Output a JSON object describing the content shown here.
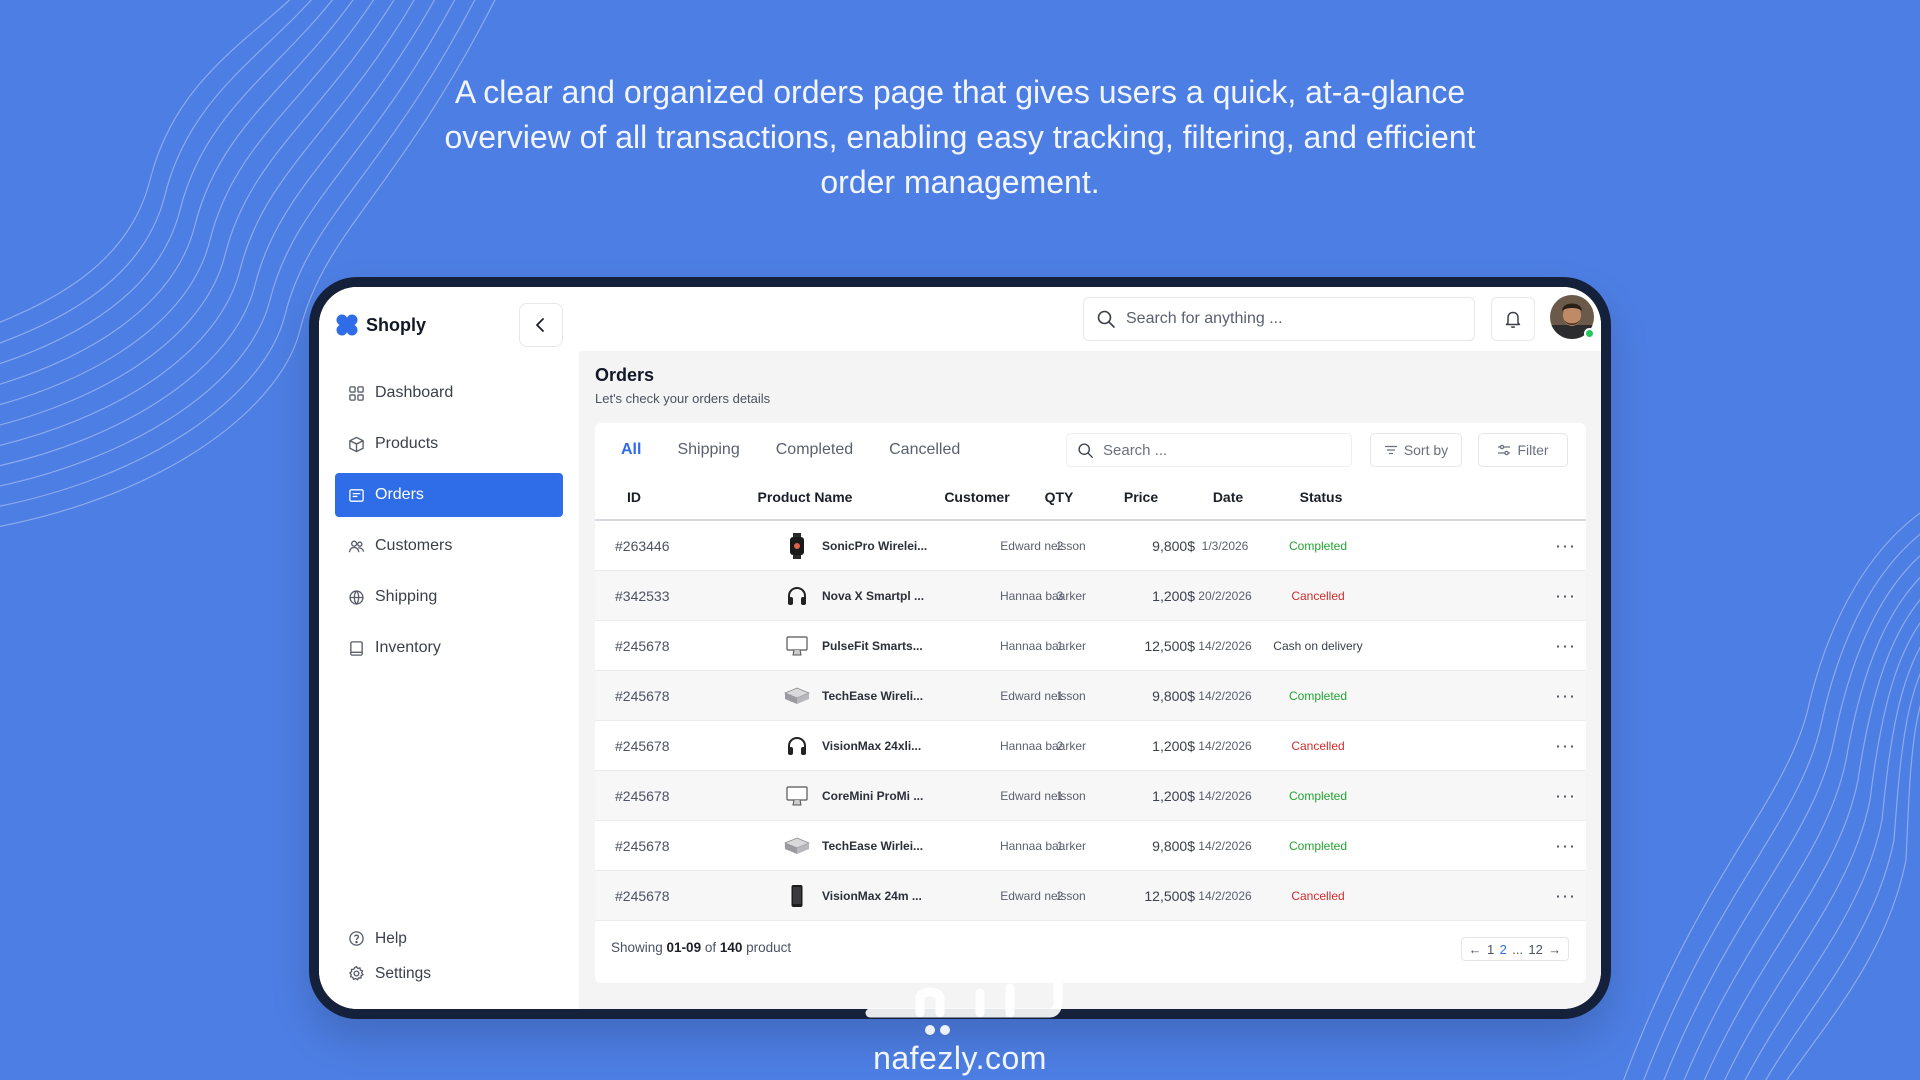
{
  "headline": {
    "line1": "A clear and organized orders page that gives users a quick, at-a-glance",
    "line2": "overview of all transactions, enabling easy tracking, filtering, and efficient",
    "line3": "order management."
  },
  "colors": {
    "accent": "#2f6de8",
    "background": "#4d7ee3",
    "completed": "#22a531",
    "cancelled": "#d12b2b"
  },
  "sidebar": {
    "brand": "Shoply",
    "items": [
      {
        "label": "Dashboard",
        "icon": "dashboard-icon"
      },
      {
        "label": "Products",
        "icon": "box-icon"
      },
      {
        "label": "Orders",
        "icon": "orders-icon",
        "active": true
      },
      {
        "label": "Customers",
        "icon": "users-icon"
      },
      {
        "label": "Shipping",
        "icon": "truck-icon"
      },
      {
        "label": "Inventory",
        "icon": "inventory-icon"
      }
    ],
    "bottom": [
      {
        "label": "Help",
        "icon": "help-icon"
      },
      {
        "label": "Settings",
        "icon": "gear-icon"
      }
    ]
  },
  "topbar": {
    "search_placeholder": "Search for anything ..."
  },
  "page": {
    "title": "Orders",
    "subtitle": "Let's check your orders details"
  },
  "tabs": [
    "All",
    "Shipping",
    "Completed",
    "Cancelled"
  ],
  "toolbar": {
    "search_placeholder": "Search ...",
    "sort_label": "Sort by",
    "filter_label": "Filter"
  },
  "table": {
    "headers": [
      "ID",
      "Product Name",
      "Customer",
      "QTY",
      "Price",
      "Date",
      "Status"
    ],
    "rows": [
      {
        "id": "#263446",
        "icon": "watch-icon",
        "name": "SonicPro Wirelei...",
        "customer": "Edward nelsson",
        "qty": "2",
        "price": "9,800$",
        "date": "1/3/2026",
        "status": "Completed"
      },
      {
        "id": "#342533",
        "icon": "headphones-icon",
        "name": "Nova X Smartpl ...",
        "customer": "Hannaa baarker",
        "qty": "3",
        "price": "1,200$",
        "date": "20/2/2026",
        "status": "Cancelled"
      },
      {
        "id": "#245678",
        "icon": "monitor-icon",
        "name": "PulseFit Smarts...",
        "customer": "Hannaa baarker",
        "qty": "1",
        "price": "12,500$",
        "date": "14/2/2026",
        "status": "Cash on delivery"
      },
      {
        "id": "#245678",
        "icon": "mac-mini-icon",
        "name": "TechEase Wireli...",
        "customer": "Edward nelsson",
        "qty": "1",
        "price": "9,800$",
        "date": "14/2/2026",
        "status": "Completed"
      },
      {
        "id": "#245678",
        "icon": "headphones-icon",
        "name": "VisionMax 24xli...",
        "customer": "Hannaa baarker",
        "qty": "2",
        "price": "1,200$",
        "date": "14/2/2026",
        "status": "Cancelled"
      },
      {
        "id": "#245678",
        "icon": "monitor-icon",
        "name": "CoreMini ProMi ...",
        "customer": "Edward nelsson",
        "qty": "1",
        "price": "1,200$",
        "date": "14/2/2026",
        "status": "Completed"
      },
      {
        "id": "#245678",
        "icon": "mac-mini-icon",
        "name": "TechEase Wirlei...",
        "customer": "Hannaa baarker",
        "qty": "1",
        "price": "9,800$",
        "date": "14/2/2026",
        "status": "Completed"
      },
      {
        "id": "#245678",
        "icon": "phone-icon",
        "name": "VisionMax 24m ...",
        "customer": "Edward nelsson",
        "qty": "2",
        "price": "12,500$",
        "date": "14/2/2026",
        "status": "Cancelled"
      }
    ]
  },
  "pagination": {
    "showing_prefix": "Showing ",
    "range": "01-09",
    "of_text": " of ",
    "total": "140",
    "suffix": " product",
    "pages": [
      "1",
      "2",
      "...",
      "12"
    ],
    "current": "2"
  },
  "watermark": {
    "text": "nafezly.com",
    "arabic": "نفذلي"
  }
}
